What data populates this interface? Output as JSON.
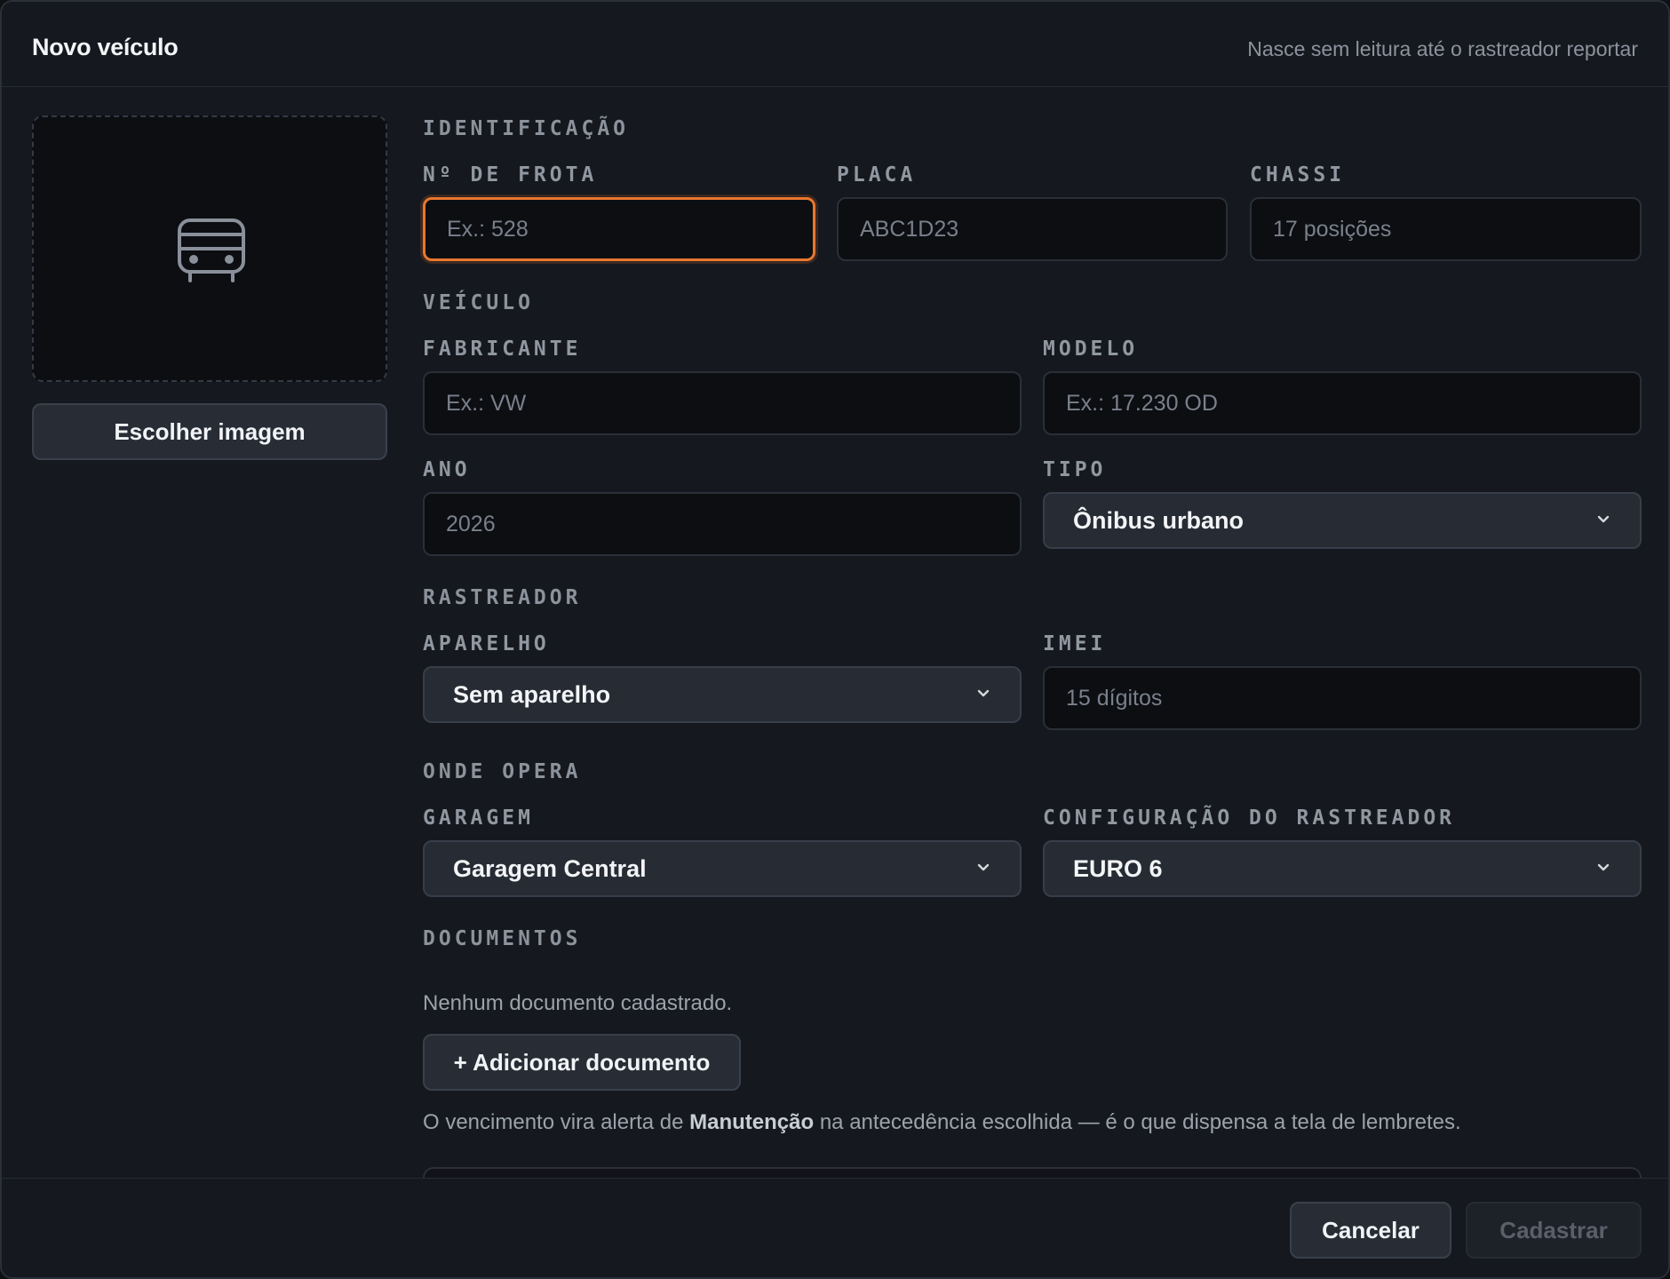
{
  "dialog": {
    "title": "Novo veículo",
    "subtitle": "Nasce sem leitura até o rastreador reportar"
  },
  "media": {
    "icon": "bus-icon",
    "choose_image_label": "Escolher imagem"
  },
  "sections": {
    "identificacao": "IDENTIFICAÇÃO",
    "veiculo": "VEÍCULO",
    "rastreador": "RASTREADOR",
    "onde_opera": "ONDE OPERA",
    "documentos": "DOCUMENTOS"
  },
  "fields": {
    "frota": {
      "label": "Nº DE FROTA",
      "placeholder": "Ex.: 528"
    },
    "placa": {
      "label": "PLACA",
      "placeholder": "ABC1D23"
    },
    "chassi": {
      "label": "CHASSI",
      "placeholder": "17 posições"
    },
    "fabricante": {
      "label": "FABRICANTE",
      "placeholder": "Ex.: VW"
    },
    "modelo": {
      "label": "MODELO",
      "placeholder": "Ex.: 17.230 OD"
    },
    "ano": {
      "label": "ANO",
      "placeholder": "2026"
    },
    "tipo": {
      "label": "TIPO",
      "value": "Ônibus urbano"
    },
    "aparelho": {
      "label": "APARELHO",
      "value": "Sem aparelho"
    },
    "imei": {
      "label": "IMEI",
      "placeholder": "15 dígitos"
    },
    "garagem": {
      "label": "GARAGEM",
      "value": "Garagem Central"
    },
    "config": {
      "label": "CONFIGURAÇÃO DO RASTREADOR",
      "value": "EURO 6"
    }
  },
  "documents": {
    "empty_text": "Nenhum documento cadastrado.",
    "add_label": "+ Adicionar documento",
    "note_prefix": "O vencimento vira alerta de ",
    "note_bold": "Manutenção",
    "note_suffix": " na antecedência escolhida — é o que dispensa a tela de lembretes."
  },
  "footer": {
    "cancel_label": "Cancelar",
    "submit_label": "Cadastrar"
  },
  "colors": {
    "accent": "#e8772e",
    "background": "#15181e",
    "input_bg": "#0c0e12"
  }
}
